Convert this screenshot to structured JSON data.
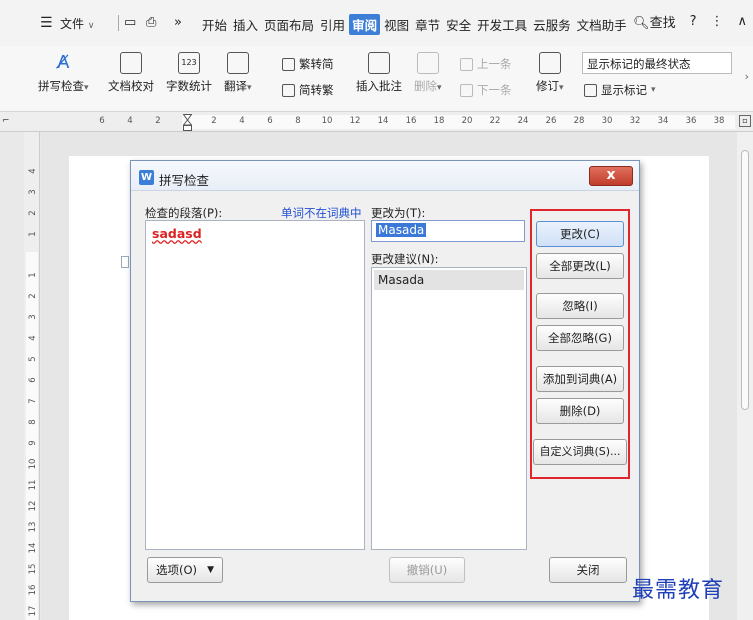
{
  "menubar": {
    "file_label": "文件",
    "tabs": [
      "开始",
      "插入",
      "页面布局",
      "引用",
      "审阅",
      "视图",
      "章节",
      "安全",
      "开发工具",
      "云服务",
      "文档助手"
    ],
    "active_tab": "审阅",
    "search_label": "查找",
    "more_chevron": "»"
  },
  "ribbon": {
    "spell_check": "拼写检查",
    "doc_proof": "文档校对",
    "word_count": "字数统计",
    "translate": "翻译",
    "trad_simp": "繁转简",
    "simp_trad": "简转繁",
    "insert_comment": "插入批注",
    "delete": "删除",
    "prev": "上一条",
    "next": "下一条",
    "track": "修订",
    "show_markup": "显示标记",
    "markup_state": "显示标记的最终状态",
    "word_count_icon_text": "123"
  },
  "ruler": {
    "horizontal": [
      "6",
      "4",
      "2",
      "2",
      "4",
      "6",
      "8",
      "10",
      "12",
      "14",
      "16",
      "18",
      "20",
      "22",
      "24",
      "26",
      "28",
      "30",
      "32",
      "34",
      "36",
      "38"
    ],
    "vertical": [
      "4",
      "3",
      "2",
      "1",
      "1",
      "2",
      "3",
      "4",
      "5",
      "6",
      "7",
      "8",
      "9",
      "10",
      "11",
      "12",
      "13",
      "14",
      "15",
      "16",
      "17"
    ]
  },
  "dialog": {
    "title": "拼写检查",
    "icon_letter": "W",
    "close": "x",
    "checked_paragraph_label": "检查的段落(P):",
    "not_in_dict_label": "单词不在词典中",
    "misspelled_word": "sadasd",
    "change_to_label": "更改为(T):",
    "change_to_value": "Masada",
    "suggestions_label": "更改建议(N):",
    "suggestions": [
      "Masada"
    ],
    "buttons": {
      "change": "更改(C)",
      "change_all": "全部更改(L)",
      "ignore": "忽略(I)",
      "ignore_all": "全部忽略(G)",
      "add_to_dict": "添加到词典(A)",
      "delete": "删除(D)",
      "custom_dict": "自定义词典(S)...",
      "options": "选项(O)",
      "undo": "撤销(U)",
      "close": "关闭"
    }
  },
  "watermark": "最需教育"
}
